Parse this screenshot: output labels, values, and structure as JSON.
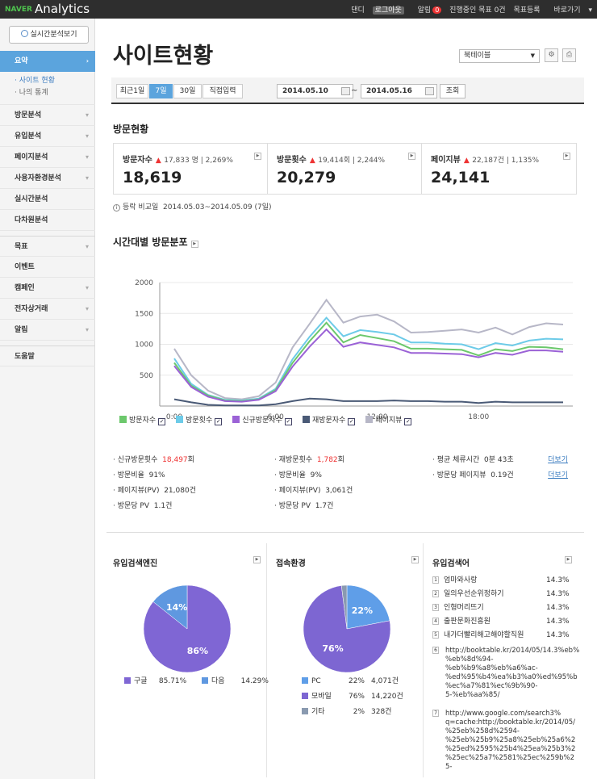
{
  "topbar": {
    "brand": "NAVER",
    "product": "Analytics",
    "user": "댄디",
    "logout": "로그아웃",
    "alert_label": "알림",
    "alert_count": "0",
    "goal_progress": "진행중인 목표 0건",
    "goal_register": "목표등록",
    "shortcut": "바로가기"
  },
  "sidebar": {
    "realtime_button": "실시간분석보기",
    "active_item": "요약",
    "sub_items": [
      {
        "label": "사이트 현황",
        "active": true
      },
      {
        "label": "나의 통계",
        "active": false
      }
    ],
    "items": [
      {
        "label": "방문분석",
        "arrow": true
      },
      {
        "label": "유입분석",
        "arrow": true
      },
      {
        "label": "페이지분석",
        "arrow": true
      },
      {
        "label": "사용자환경분석",
        "arrow": true
      },
      {
        "label": "실시간분석",
        "arrow": false
      },
      {
        "label": "다차원분석",
        "arrow": false
      },
      {
        "label": "목표",
        "arrow": true
      },
      {
        "label": "이벤트",
        "arrow": false
      },
      {
        "label": "캠페인",
        "arrow": true
      },
      {
        "label": "전자상거래",
        "arrow": true
      },
      {
        "label": "알림",
        "arrow": true
      },
      {
        "label": "도움말",
        "arrow": false
      }
    ]
  },
  "header": {
    "title": "사이트현황",
    "site_select": "북테이블"
  },
  "datebar": {
    "tabs": [
      {
        "label": "최근1일",
        "active": false
      },
      {
        "label": "7일",
        "active": true
      },
      {
        "label": "30일",
        "active": false
      },
      {
        "label": "직접입력",
        "active": false
      }
    ],
    "start": "2014.05.10",
    "end": "2014.05.16",
    "query": "조회"
  },
  "visit_section": {
    "title": "방문현황",
    "cards": [
      {
        "label": "방문자수",
        "compare": "17,833 명",
        "rate": "2,269%",
        "value": "18,619"
      },
      {
        "label": "방문횟수",
        "compare": "19,414회",
        "rate": "2,244%",
        "value": "20,279"
      },
      {
        "label": "페이지뷰",
        "compare": "22,187건",
        "rate": "1,135%",
        "value": "24,141"
      }
    ],
    "compare_note_label": "등락 비교일",
    "compare_note_value": "2014.05.03~2014.05.09 (7일)"
  },
  "hourly": {
    "title": "시간대별 방문분포"
  },
  "chart_data": {
    "type": "line",
    "x": [
      "0:00",
      "1:00",
      "2:00",
      "3:00",
      "4:00",
      "5:00",
      "6:00",
      "7:00",
      "8:00",
      "9:00",
      "10:00",
      "11:00",
      "12:00",
      "13:00",
      "14:00",
      "15:00",
      "16:00",
      "17:00",
      "18:00",
      "19:00",
      "20:00",
      "21:00",
      "22:00",
      "23:00"
    ],
    "x_ticks": [
      "0:00",
      "6:00",
      "12:00",
      "18:00"
    ],
    "y_ticks": [
      500,
      1000,
      1500,
      2000
    ],
    "ylim": [
      0,
      2000
    ],
    "grid": true,
    "legend_position": "bottom",
    "series": [
      {
        "name": "방문자수",
        "color": "#6cc86c",
        "values": [
          700,
          330,
          170,
          90,
          80,
          110,
          260,
          700,
          1050,
          1350,
          1030,
          1150,
          1100,
          1050,
          930,
          930,
          920,
          910,
          820,
          920,
          890,
          960,
          950,
          920
        ]
      },
      {
        "name": "방문횟수",
        "color": "#6dcbe8",
        "values": [
          770,
          360,
          180,
          100,
          90,
          120,
          280,
          760,
          1120,
          1430,
          1130,
          1230,
          1200,
          1160,
          1030,
          1030,
          1010,
          1000,
          920,
          1020,
          980,
          1060,
          1090,
          1080
        ]
      },
      {
        "name": "신규방문자수",
        "color": "#9b62d6",
        "values": [
          650,
          310,
          150,
          80,
          70,
          100,
          240,
          640,
          960,
          1240,
          960,
          1030,
          990,
          950,
          860,
          860,
          850,
          840,
          790,
          860,
          830,
          900,
          900,
          880
        ]
      },
      {
        "name": "재방문자수",
        "color": "#4a5a76",
        "values": [
          110,
          60,
          20,
          10,
          10,
          10,
          30,
          80,
          120,
          110,
          80,
          80,
          80,
          90,
          80,
          80,
          70,
          70,
          50,
          70,
          60,
          60,
          60,
          60
        ]
      },
      {
        "name": "페이지뷰",
        "color": "#b7b7c7",
        "values": [
          930,
          500,
          250,
          130,
          110,
          160,
          380,
          950,
          1330,
          1720,
          1350,
          1450,
          1480,
          1370,
          1190,
          1200,
          1220,
          1240,
          1190,
          1270,
          1160,
          1280,
          1340,
          1320
        ]
      }
    ]
  },
  "details": {
    "col1": [
      {
        "label": "신규방문횟수",
        "value": "18,497",
        "unit": "회",
        "highlight": true
      },
      {
        "label": "방문비율",
        "value": "91%",
        "unit": "",
        "highlight": false
      },
      {
        "label": "페이지뷰(PV)",
        "value": "21,080건",
        "unit": "",
        "highlight": false
      },
      {
        "label": "방문당 PV",
        "value": "1.1건",
        "unit": "",
        "highlight": false
      }
    ],
    "col2": [
      {
        "label": "재방문횟수",
        "value": "1,782",
        "unit": "회",
        "highlight": true
      },
      {
        "label": "방문비율",
        "value": "9%",
        "unit": "",
        "highlight": false
      },
      {
        "label": "페이지뷰(PV)",
        "value": "3,061건",
        "unit": "",
        "highlight": false
      },
      {
        "label": "방문당 PV",
        "value": "1.7건",
        "unit": "",
        "highlight": false
      }
    ],
    "col3": [
      {
        "label": "평균 체류시간",
        "value": "0분 43초",
        "link": "더보기"
      },
      {
        "label": "방문당 페이지뷰",
        "value": "0.19건",
        "link": "더보기"
      }
    ]
  },
  "search_engine": {
    "title": "유입검색엔진",
    "slices": [
      {
        "name": "구글",
        "percent": 85.71,
        "display": "85.71%",
        "pie_label": "86%",
        "color": "#7f66d4"
      },
      {
        "name": "다음",
        "percent": 14.29,
        "display": "14.29%",
        "pie_label": "14%",
        "color": "#5f98e0"
      }
    ]
  },
  "environment": {
    "title": "접속환경",
    "slices": [
      {
        "name": "PC",
        "percent": 22,
        "display": "22%",
        "count": "4,071건",
        "pie_label": "22%",
        "color": "#5f9ee8"
      },
      {
        "name": "모바일",
        "percent": 76,
        "display": "76%",
        "count": "14,220건",
        "pie_label": "76%",
        "color": "#7d66d2"
      },
      {
        "name": "기타",
        "percent": 2,
        "display": "2%",
        "count": "328건",
        "pie_label": "",
        "color": "#8a9ab0"
      }
    ]
  },
  "keywords": {
    "title": "유입검색어",
    "items": [
      {
        "n": "1",
        "text": "엄마와사랑",
        "pct": "14.3%"
      },
      {
        "n": "2",
        "text": "일의우선순위정하기",
        "pct": "14.3%"
      },
      {
        "n": "3",
        "text": "인형머리뜨기",
        "pct": "14.3%"
      },
      {
        "n": "4",
        "text": "출판문화진흥원",
        "pct": "14.3%"
      },
      {
        "n": "5",
        "text": "내가더빨리해고해야할직원",
        "pct": "14.3%"
      }
    ],
    "url_items": [
      {
        "n": "6",
        "text": "http://booktable.kr/2014/05/14.3%eb%\n%eb%8d%94-\n%eb%b9%a8%eb%a6%ac-\n%ed%95%b4%ea%b3%a0%ed%95%b\n%ec%a7%81%ec%9b%90-\n5-%eb%aa%85/"
      },
      {
        "n": "7",
        "text": "http://www.google.com/search3%\nq=cache:http://booktable.kr/2014/05/\n%25eb%258d%2594-\n%25eb%25b9%25a8%25eb%25a6%2\n%25ed%2595%25b4%25ea%25b3%2\n%25ec%25a7%2581%25ec%259b%2\n5-"
      }
    ]
  }
}
